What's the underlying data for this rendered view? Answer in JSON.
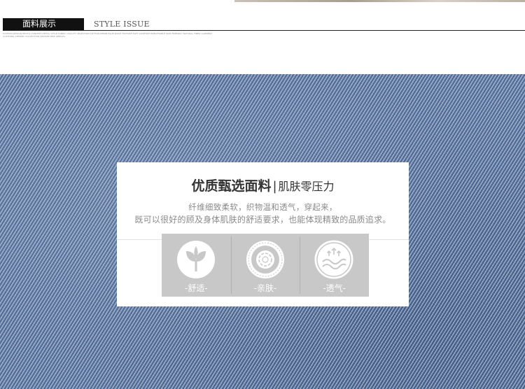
{
  "header": {
    "title_cn": "面料展示",
    "title_en": "STYLE ISSUE",
    "fine_print": "FASHION DESIGN PHOTO CONCEPT DETAIL STYLE FABRIC QUALITY SELECTION COTTON DENIM BLUE WASH TEXTURE SOFT COMFORT BREATHABLE SKIN FRIENDLY NATURAL FIBER GARMENT CLOTHING APPAREL COLLECTION SEASON NEW ARRIVAL"
  },
  "card": {
    "title_main": "优质甄选面料",
    "title_sep": "|",
    "title_sub": "肌肤零压力",
    "line1": "纤维细致柔软，织物温和透气，穿起来，",
    "line2": "既可以很好的顾及身体肌肤的舒适要求，也能体现精致的品质追求。",
    "features": [
      {
        "icon": "leaf-icon",
        "label": "-舒适-"
      },
      {
        "icon": "cotton-badge-icon",
        "label": "-亲肤-"
      },
      {
        "icon": "airflow-icon",
        "label": "-透气-"
      }
    ],
    "badge_ring_text": "COTTON · COTTON · COTTON · COTTON ·"
  },
  "colors": {
    "denim": "#5d7aa6",
    "feature_panel": "#c8c8c8",
    "header_black": "#111111"
  }
}
